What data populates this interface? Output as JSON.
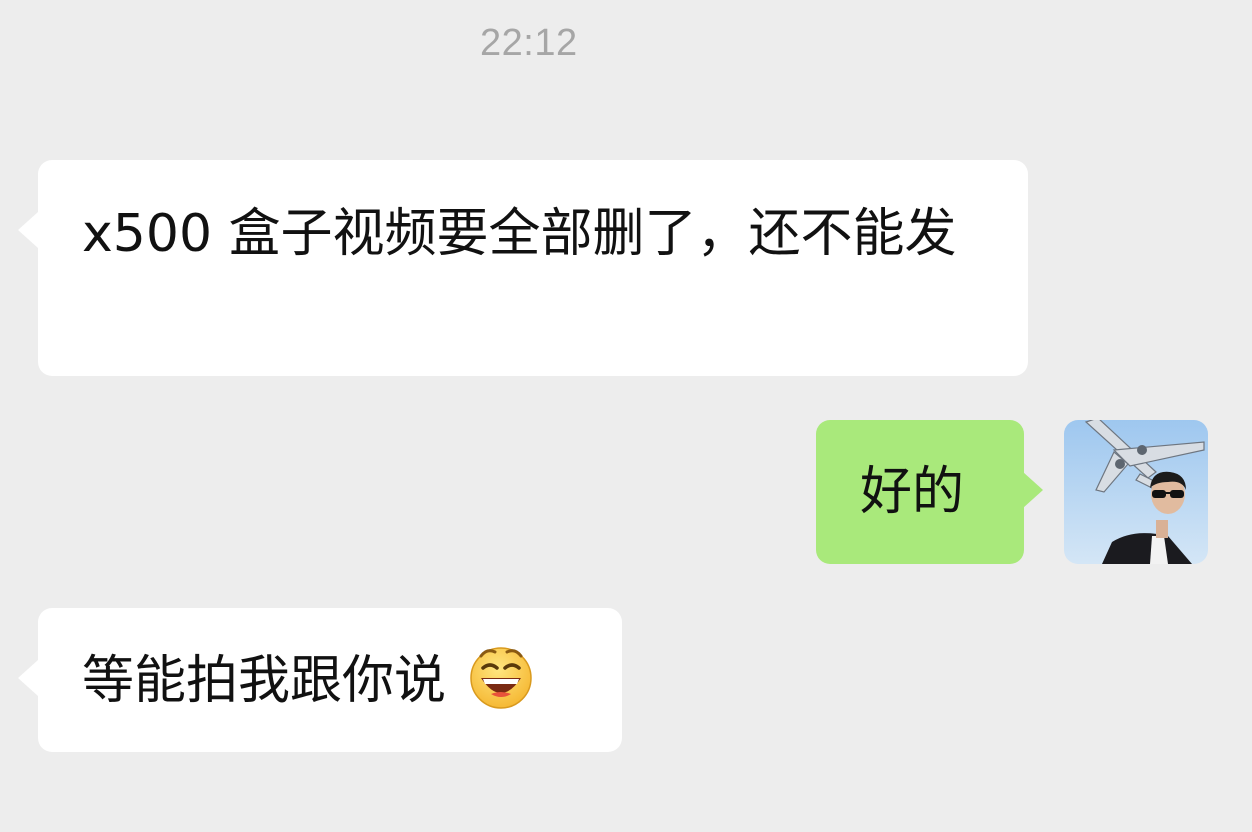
{
  "chat": {
    "timestamp": "22:12",
    "messages": [
      {
        "direction": "received",
        "text": "x500 盒子视频要全部删了，还不能发"
      },
      {
        "direction": "sent",
        "text": "好的"
      },
      {
        "direction": "received",
        "text": "等能拍我跟你说",
        "emoji": "grinning-face-emoji"
      }
    ],
    "avatar_icon": "airplane-photo-avatar"
  },
  "colors": {
    "background": "#ededed",
    "received_bubble": "#ffffff",
    "sent_bubble": "#a9e97b",
    "timestamp_text": "#a6a6a6"
  }
}
